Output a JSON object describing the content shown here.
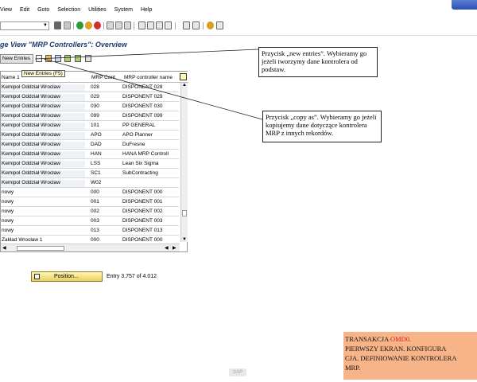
{
  "menubar": {
    "items": [
      "View",
      "Edit",
      "Goto",
      "Selection",
      "Utilities",
      "System",
      "Help"
    ]
  },
  "title": "ge View \"MRP Controllers\": Overview",
  "app_toolbar": {
    "new_entries_label": "New Entries",
    "tooltip": "New Entries   (F5)"
  },
  "table": {
    "headers": [
      "Name 1",
      "MRP Cont.",
      "MRP controller name"
    ],
    "rows": [
      {
        "name": "Kemipol Oddział Wrocław",
        "code": "028",
        "controller": "DISPONENT 028"
      },
      {
        "name": "Kemipol Oddział Wrocław",
        "code": "029",
        "controller": "DISPONENT 029"
      },
      {
        "name": "Kemipol Oddział Wrocław",
        "code": "030",
        "controller": "DISPONENT 030"
      },
      {
        "name": "Kemipol Oddział Wrocław",
        "code": "099",
        "controller": "DISPONENT 099"
      },
      {
        "name": "Kemipol Oddział Wrocław",
        "code": "101",
        "controller": "PP GENERAL"
      },
      {
        "name": "Kemipol Oddział Wrocław",
        "code": "APO",
        "controller": "APO Planner"
      },
      {
        "name": "Kemipol Oddział Wrocław",
        "code": "DAD",
        "controller": "DuFresne"
      },
      {
        "name": "Kemipol Oddział Wrocław",
        "code": "HAN",
        "controller": "HANA MRP Controll"
      },
      {
        "name": "Kemipol Oddział Wrocław",
        "code": "LSS",
        "controller": "Lean Six Sigma"
      },
      {
        "name": "Kemipol Oddział Wrocław",
        "code": "SC1",
        "controller": "SubContracting"
      },
      {
        "name": "Kemipol Oddział Wrocław",
        "code": "W02",
        "controller": ""
      },
      {
        "name": "nowy",
        "code": "000",
        "controller": "DISPONENT 000"
      },
      {
        "name": "nowy",
        "code": "001",
        "controller": "DISPONENT 001"
      },
      {
        "name": "nowy",
        "code": "002",
        "controller": "DISPONENT 002"
      },
      {
        "name": "nowy",
        "code": "003",
        "controller": "DISPONENT 003"
      },
      {
        "name": "nowy",
        "code": "013",
        "controller": "DISPONENT 013"
      },
      {
        "name": "Zakład Wrocław 1",
        "code": "000",
        "controller": "DISPONENT 000"
      }
    ]
  },
  "position_button": "Position...",
  "entry_info": "Entry 3.757 of 4.012",
  "callouts": {
    "new_entries": "Przycisk „new entries”. Wybieramy go jeżeli tworzymy dane kontrolera od podstaw.",
    "copy_as": "Przycisk „copy as”. Wybieramy go jeżeli kopiujemy dane dotyczące kontrolera MRP z innych rekordów."
  },
  "caption": {
    "line1_prefix": "TRANSAKCJA ",
    "line1_tx": "OMD0.",
    "line2": "PIERWSZY EKRAN. KONFIGURA",
    "line3": "CJA. DEFINIOWANIE KONTROLERA",
    "line4": "MRP."
  },
  "logo_text": "SAP",
  "colors": {
    "caption_bg": "#f7b488",
    "caption_tx": "#e02020",
    "title": "#1a3a6b"
  }
}
